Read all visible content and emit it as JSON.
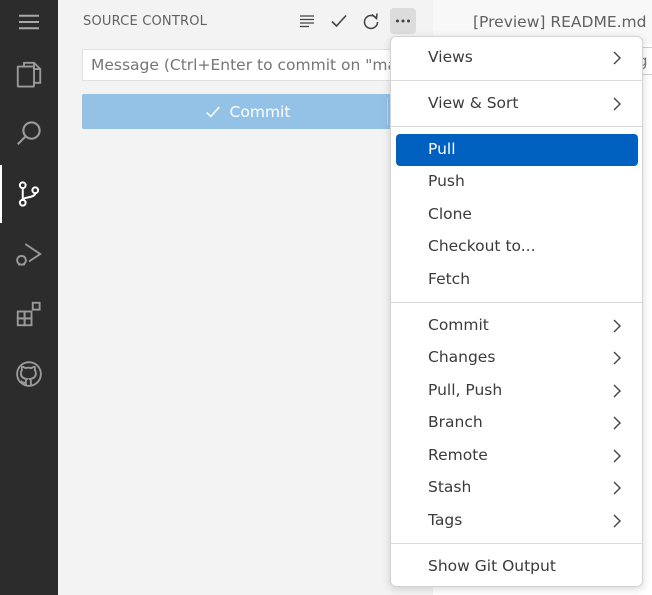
{
  "sidebar": {
    "title": "SOURCE CONTROL",
    "message_placeholder": "Message (Ctrl+Enter to commit on \"maste",
    "commit_label": "Commit"
  },
  "editor": {
    "tab_label": "[Preview] README.md",
    "input_fragment": "g"
  },
  "menu": {
    "items": [
      {
        "label": "Views",
        "submenu": true
      },
      {
        "label": "View & Sort",
        "submenu": true
      },
      {
        "label": "Pull",
        "submenu": false,
        "highlighted": true
      },
      {
        "label": "Push",
        "submenu": false
      },
      {
        "label": "Clone",
        "submenu": false
      },
      {
        "label": "Checkout to...",
        "submenu": false
      },
      {
        "label": "Fetch",
        "submenu": false
      },
      {
        "label": "Commit",
        "submenu": true
      },
      {
        "label": "Changes",
        "submenu": true
      },
      {
        "label": "Pull, Push",
        "submenu": true
      },
      {
        "label": "Branch",
        "submenu": true
      },
      {
        "label": "Remote",
        "submenu": true
      },
      {
        "label": "Stash",
        "submenu": true
      },
      {
        "label": "Tags",
        "submenu": true
      },
      {
        "label": "Show Git Output",
        "submenu": false
      }
    ]
  },
  "colors": {
    "activity_bar": "#2c2c2c",
    "highlight": "#0060c0",
    "commit_button": "#93c2e6"
  }
}
